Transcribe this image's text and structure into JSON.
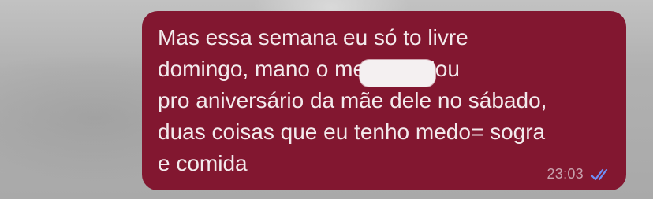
{
  "message": {
    "text": "Mas essa semana eu só to livre\ndomingo, mano o            me convidou\npro aniversário da mãe dele no sábado,\nduas coisas que eu tenho medo= sogra\ne comida",
    "timestamp": "23:03",
    "status_icon": "double-check-icon",
    "bubble_color": "#821730",
    "text_color": "#f3eaec",
    "tick_color": "#6f8ff7"
  }
}
